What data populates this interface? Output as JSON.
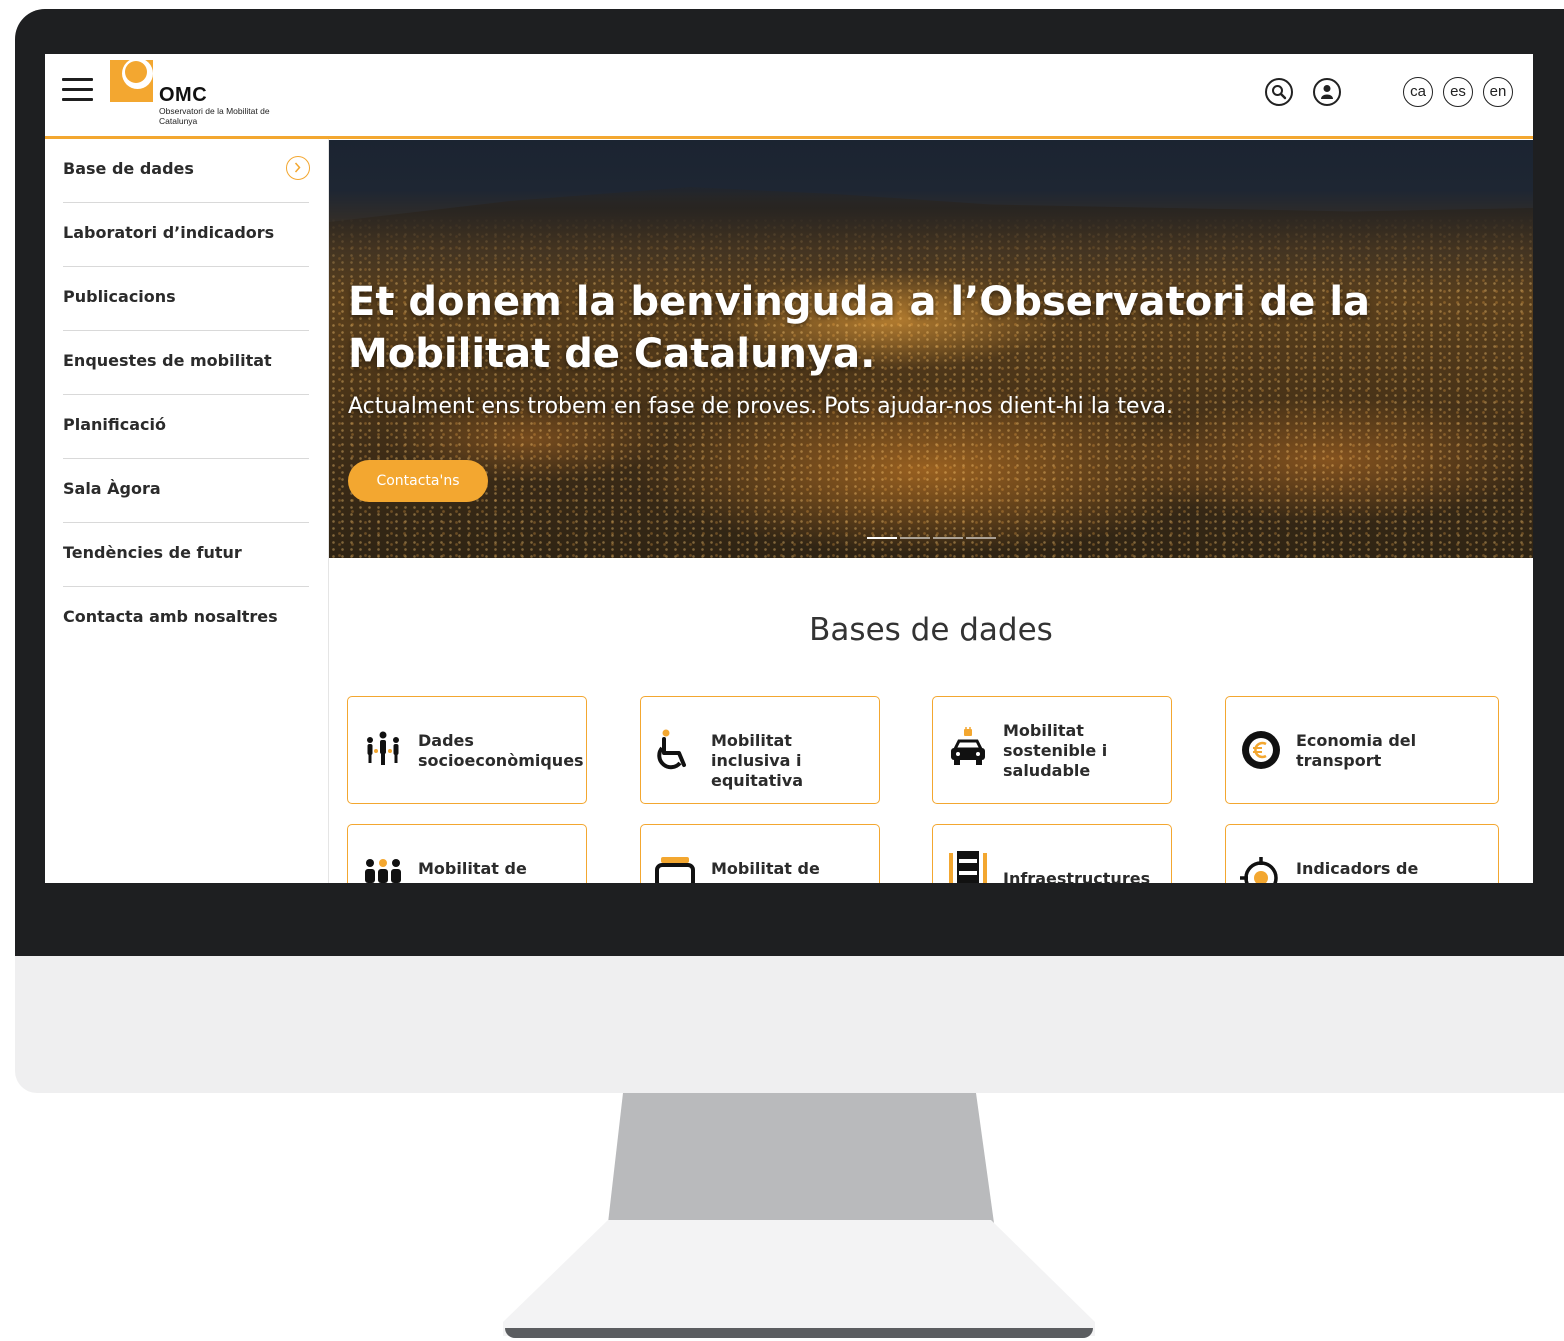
{
  "header": {
    "logo_text": "OMC",
    "logo_subtitle": "Observatori de la Mobilitat de Catalunya",
    "languages": [
      "ca",
      "es",
      "en"
    ]
  },
  "sidebar": {
    "items": [
      {
        "label": "Base de dades"
      },
      {
        "label": "Laboratori d’indicadors"
      },
      {
        "label": "Publicacions"
      },
      {
        "label": "Enquestes de mobilitat"
      },
      {
        "label": "Planificació"
      },
      {
        "label": "Sala Àgora"
      },
      {
        "label": "Tendències de futur"
      },
      {
        "label": "Contacta amb nosaltres"
      }
    ]
  },
  "hero": {
    "title": "Et donem la benvinguda a l’Observatori de la Mobilitat de Catalunya.",
    "subtitle": "Actualment ens trobem en fase de proves. Pots ajudar-nos dient-hi la teva.",
    "cta": "Contacta'ns"
  },
  "databases": {
    "title": "Bases de dades",
    "cards": [
      {
        "label": "Dades socioeconòmiques",
        "icon": "people-icon"
      },
      {
        "label": "Mobilitat inclusiva i equitativa",
        "icon": "wheelchair-icon"
      },
      {
        "label": "Mobilitat sostenible i saludable",
        "icon": "electric-car-icon"
      },
      {
        "label": "Economia del transport",
        "icon": "euro-coin-icon"
      },
      {
        "label": "Mobilitat de",
        "icon": "group-icon"
      },
      {
        "label": "Mobilitat de",
        "icon": "vehicle-icon"
      },
      {
        "label": "Infraestructures",
        "icon": "road-icon"
      },
      {
        "label": "Indicadors de",
        "icon": "target-icon"
      }
    ]
  },
  "colors": {
    "accent": "#f3a730",
    "bezel": "#1e1f21"
  }
}
